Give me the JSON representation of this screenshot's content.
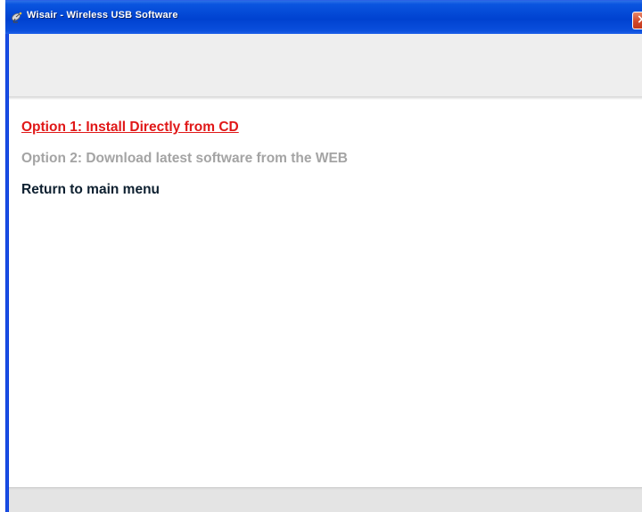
{
  "window": {
    "title": "Wisair - Wireless USB Software",
    "close_glyph": "×",
    "icon": "satellite-dish-icon"
  },
  "menu": {
    "option1": "Option 1: Install Directly from CD",
    "option2": "Option 2: Download latest software from the WEB",
    "return": "Return to main menu"
  },
  "colors": {
    "titlebar": "#0042d0",
    "option1_active": "#e01818",
    "option2_inactive": "#a4a4a4",
    "return_link": "#0e2030",
    "header_band": "#eeeeee",
    "footer_band": "#e4e4e4"
  }
}
